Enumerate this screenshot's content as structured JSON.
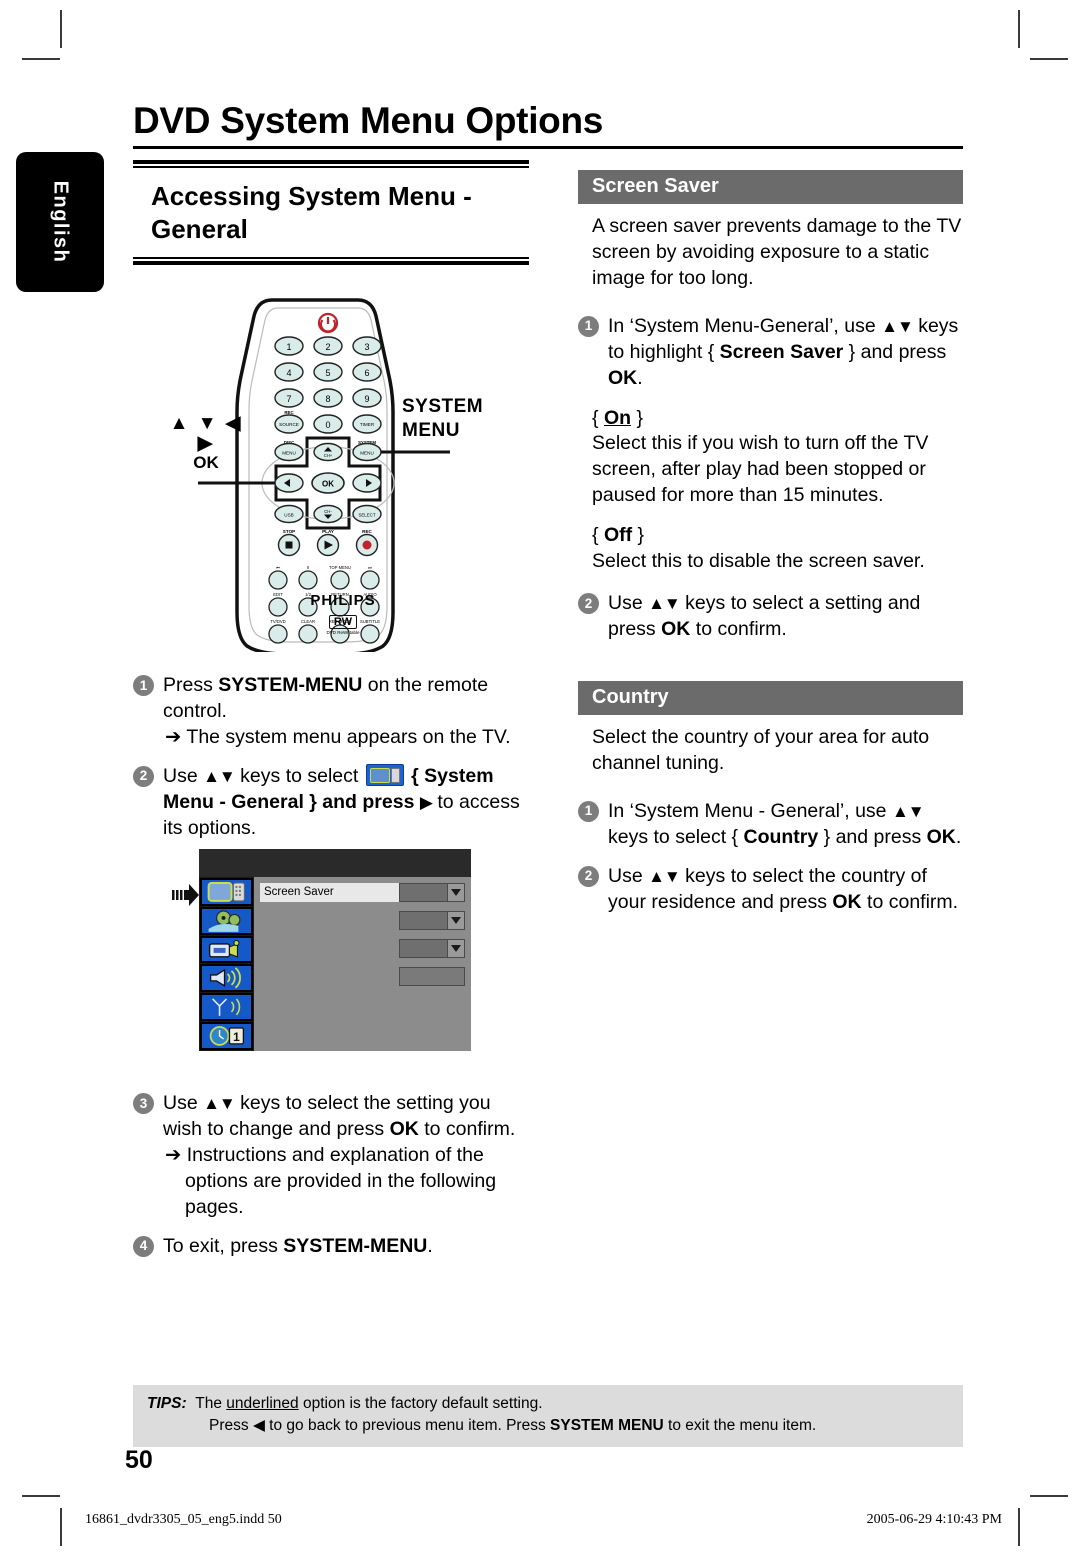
{
  "document": {
    "page_title": "DVD System Menu Options",
    "page_number": "50",
    "language_tab": "English",
    "footer_left": "16861_dvdr3305_05_eng5.indd   50",
    "footer_right": "2005-06-29   4:10:43 PM"
  },
  "left_column": {
    "section_heading": "Accessing System Menu - General",
    "remote": {
      "arrow_keys_glyphs": "▲ ▼ ◀ ▶",
      "ok_label": "OK",
      "system_menu_label_line1": "SYSTEM",
      "system_menu_label_line2": "MENU",
      "brand": "PHILIPS",
      "rw_logo": "RW",
      "rw_sub": "DVD ReWritable",
      "keypad": [
        "1",
        "2",
        "3",
        "4",
        "5",
        "6",
        "7",
        "8",
        "9",
        "0"
      ],
      "button_labels": {
        "rec_source": "REC SOURCE",
        "timer": "TIMER",
        "disc_menu": "DISC MENU",
        "system_menu": "SYSTEM MENU",
        "ch_up": "CH +",
        "ch_down": "CH -",
        "usb": "USB",
        "select": "SELECT",
        "ok": "OK",
        "stop": "STOP",
        "play": "PLAY",
        "rec": "REC",
        "prev": "⏮",
        "next": "⏭",
        "top_menu": "TOP MENU",
        "edit": "EDIT",
        "return": "RETURN",
        "audio": "AUDIO",
        "tv_dvd": "TV/DVD",
        "clear": "CLEAR",
        "rec_mode": "REC MODE",
        "subtitle": "SUBTITLE"
      }
    },
    "steps": [
      {
        "num": "1",
        "text_parts": [
          "Press ",
          "SYSTEM-MENU",
          " on the remote control."
        ],
        "sub": "➔  The system menu appears on the TV."
      },
      {
        "num": "2",
        "text_parts": [
          "Use ",
          "▲▼",
          " keys to select ",
          "[tv-icon]",
          " { ",
          "System Menu - General",
          " } and press ",
          "▶",
          " to access its options."
        ]
      },
      {
        "num": "3",
        "text_parts": [
          "Use ",
          "▲▼",
          " keys to select the setting you wish to change and press ",
          "OK",
          " to confirm."
        ],
        "sub": "➔  Instructions and explanation of the options are provided in the following pages."
      },
      {
        "num": "4",
        "text_parts": [
          "To exit, press ",
          "SYSTEM-MENU",
          "."
        ]
      }
    ],
    "tv_mockup": {
      "highlighted_row_label": "Screen Saver",
      "icon_names": [
        "general-setup-icon",
        "playback-icon",
        "recording-icon",
        "sound-icon",
        "tuner-icon",
        "clock-date-icon"
      ],
      "row_count": 4,
      "pointer": "right-arrow-pointer"
    }
  },
  "right_column": {
    "sections": [
      {
        "title": "Screen Saver",
        "intro": "A screen saver prevents damage to the TV screen by avoiding exposure to a static image for too long.",
        "steps": [
          {
            "num": "1",
            "parts": [
              "In ‘System Menu-General’, use ",
              "▲▼",
              " keys to highlight { ",
              "Screen Saver",
              " } and press ",
              "OK",
              "."
            ]
          },
          {
            "num": "2",
            "parts": [
              "Use ",
              "▲▼",
              " keys to select a setting and press ",
              "OK",
              " to confirm."
            ]
          }
        ],
        "options": [
          {
            "name": "On",
            "is_default": true,
            "description": "Select this if you wish to turn off the TV screen, after play had been stopped or paused for more than 15 minutes."
          },
          {
            "name": "Off",
            "is_default": false,
            "description": "Select this to disable the screen saver."
          }
        ]
      },
      {
        "title": "Country",
        "intro": "Select the country of your area for auto channel tuning.",
        "steps": [
          {
            "num": "1",
            "parts": [
              "In ‘System Menu - General’, use ",
              "▲▼",
              " keys to select { ",
              "Country",
              " } and press ",
              "OK",
              "."
            ]
          },
          {
            "num": "2",
            "parts": [
              "Use ",
              "▲▼",
              " keys to select the country of your residence and press ",
              "OK",
              " to confirm."
            ]
          }
        ],
        "options": []
      }
    ]
  },
  "tips": {
    "label": "TIPS:",
    "line1_pre": "The ",
    "line1_underlined": "underlined",
    "line1_post": " option is the factory default setting.",
    "line2_pre": "Press ",
    "line2_glyph": "◀",
    "line2_mid": " to go back to previous menu item. Press ",
    "line2_bold": "SYSTEM MENU",
    "line2_post": " to exit the menu item."
  },
  "colors": {
    "section_bar": "#6b6b6b",
    "tips_bg": "#dcdcdc",
    "bullet": "#7d7d7d",
    "menu_bg": "#8c8c8c",
    "menu_icon_blue": "#1558c8"
  }
}
